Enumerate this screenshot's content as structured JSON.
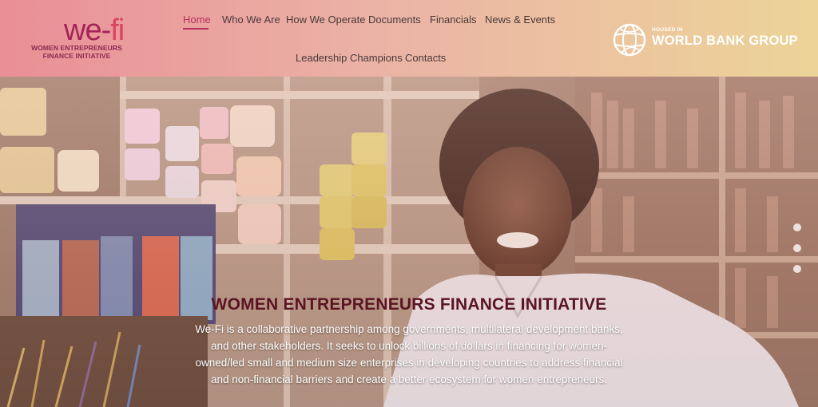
{
  "brand": {
    "logo_text_we": "we",
    "logo_text_fi": "fi",
    "caption_line1": "WOMEN ENTREPRENEURS",
    "caption_line2": "FINANCE INITIATIVE",
    "accent": "#b8305a"
  },
  "nav": {
    "items": [
      {
        "label": "Home",
        "active": true
      },
      {
        "label": "Who We Are"
      },
      {
        "label": "How We Operate"
      },
      {
        "label": "Documents"
      },
      {
        "label": "Financials"
      },
      {
        "label": "News & Events"
      },
      {
        "label": "Leadership Champions"
      },
      {
        "label": "Contacts"
      }
    ]
  },
  "partner": {
    "small": "HOUSED IN",
    "big": "WORLD BANK GROUP",
    "icon": "globe-icon"
  },
  "hero": {
    "title": "WOMEN ENTREPRENEURS FINANCE INITIATIVE",
    "line1": "We-Fi is a collaborative partnership among governments, multilateral development banks,",
    "line2": "and other stakeholders. It seeks to unlock billions of dollars in financing for women-",
    "line3": "owned/led small and medium size enterprises in developing countries to address financial",
    "line4": "and non-financial barriers and create a better ecosystem for women entrepreneurs.",
    "slide_count": 3
  },
  "colors": {
    "header_left": "#e98f95",
    "header_right": "#ecd498",
    "title_color": "#5a1422"
  }
}
